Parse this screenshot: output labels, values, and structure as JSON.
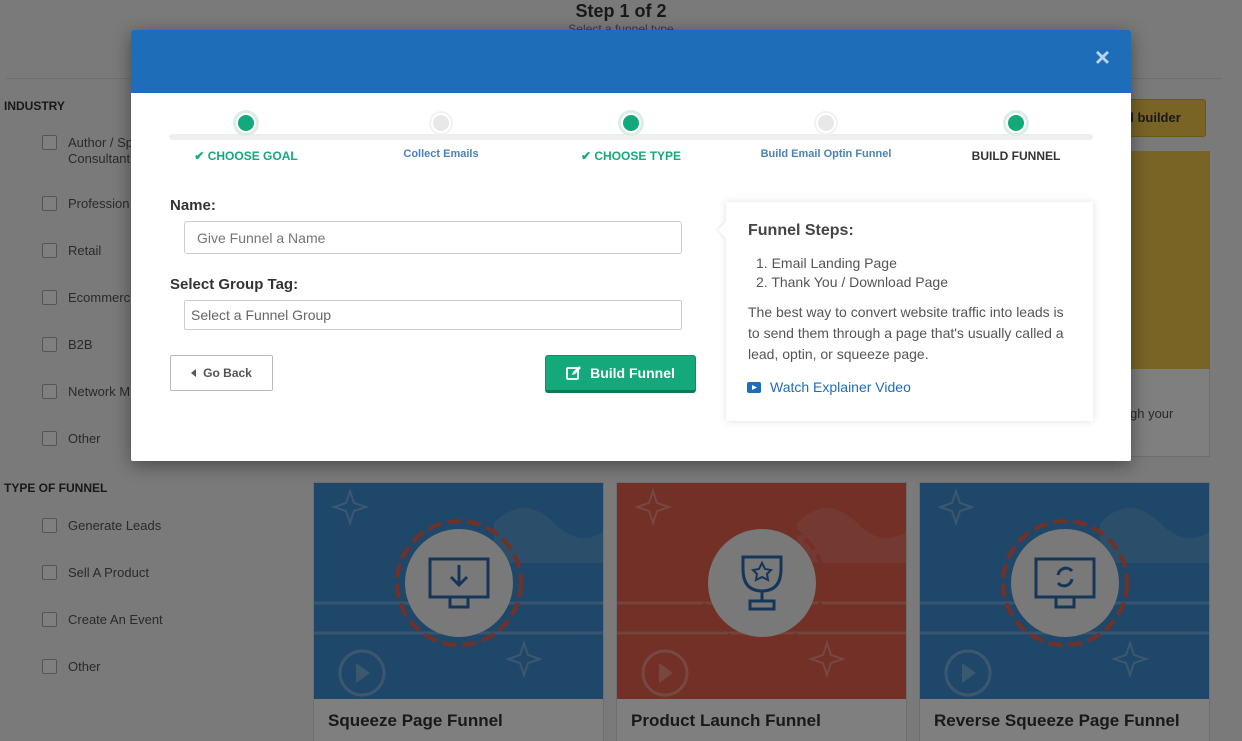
{
  "background": {
    "page_title": "Step 1 of 2",
    "page_subtitle": "Select a funnel type",
    "funnel_builder_button": "el builder",
    "card_text_fragment": "gh your",
    "industry": {
      "heading": "INDUSTRY",
      "items": [
        "Author / Sp Consultant",
        "Profession",
        "Retail",
        "Ecommerc",
        "B2B",
        "Network M",
        "Other"
      ]
    },
    "type_of_funnel": {
      "heading": "TYPE OF FUNNEL",
      "items": [
        "Generate Leads",
        "Sell A Product",
        "Create An Event",
        "Other"
      ]
    },
    "funnel_cards": [
      {
        "title": "Squeeze Page Funnel",
        "color": "#3f8fd2",
        "icon": "download-screen-icon"
      },
      {
        "title": "Product Launch Funnel",
        "color": "#e5604e",
        "icon": "trophy-icon"
      },
      {
        "title": "Reverse Squeeze Page Funnel",
        "color": "#3f8fd2",
        "icon": "refresh-screen-icon"
      }
    ]
  },
  "modal": {
    "close_symbol": "×",
    "steps": [
      {
        "label": "CHOOSE GOAL",
        "state": "done",
        "check": "✔"
      },
      {
        "label": "Collect Emails",
        "state": "pending"
      },
      {
        "label": "CHOOSE TYPE",
        "state": "done",
        "check": "✔"
      },
      {
        "label": "Build Email Optin Funnel",
        "state": "pending"
      },
      {
        "label": "BUILD FUNNEL",
        "state": "current"
      }
    ],
    "form": {
      "name_label": "Name:",
      "name_placeholder": "Give Funnel a Name",
      "group_label": "Select Group Tag:",
      "group_placeholder": "Select a Funnel Group",
      "go_back_label": "Go Back",
      "build_label": "Build Funnel"
    },
    "info": {
      "title": "Funnel Steps:",
      "steps": [
        "1. Email Landing Page",
        "2. Thank You / Download Page"
      ],
      "description": "The best way to convert website traffic into leads is to send them through a page that's usually called a lead, optin, or squeeze page.",
      "video_link": "Watch Explainer Video"
    },
    "colors": {
      "header": "#1e6db8",
      "accent_green": "#13a97b",
      "link_blue": "#1e6db8"
    }
  }
}
